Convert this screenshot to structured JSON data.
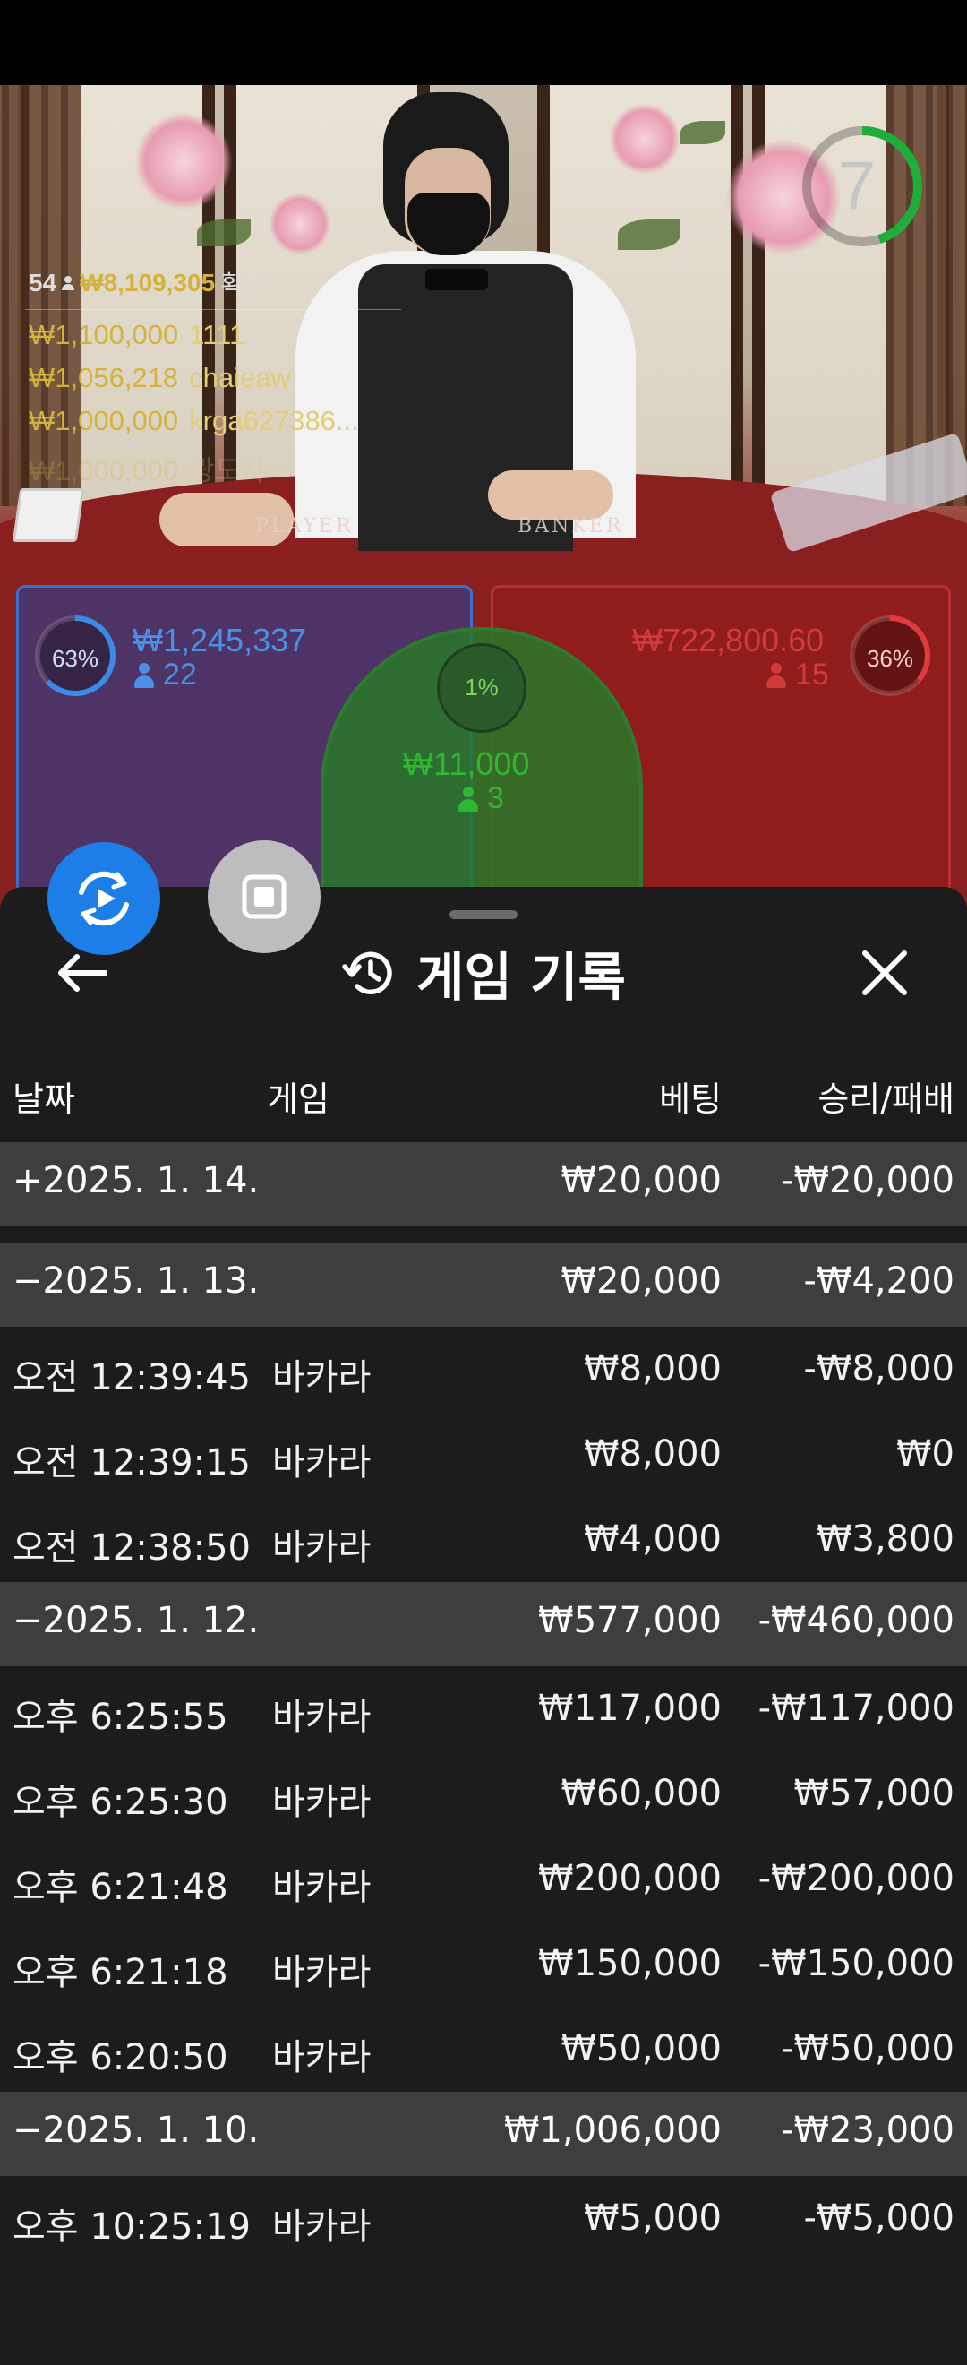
{
  "game_view": {
    "timer_value": "7",
    "timer_progress": 0.45,
    "summary": {
      "player_count": "54",
      "total_amount": "₩8,109,305",
      "total_label": "획득"
    },
    "winners": [
      {
        "amount": "₩1,100,000",
        "name": "1111"
      },
      {
        "amount": "₩1,056,218",
        "name": "chaieaw"
      },
      {
        "amount": "₩1,000,000",
        "name": "krga627386..."
      },
      {
        "amount": "₩1,000,000",
        "name": "광도사"
      }
    ],
    "table_labels": {
      "player": "PLAYER",
      "banker": "BANKER"
    },
    "player_zone": {
      "percent_label": "63%",
      "percent": 63,
      "amount": "₩1,245,337",
      "count": "22",
      "color": "#3a6fd0"
    },
    "banker_zone": {
      "percent_label": "36%",
      "percent": 36,
      "amount": "₩722,800.60",
      "count": "15",
      "color": "#d23a3a"
    },
    "tie_zone": {
      "percent_label": "1%",
      "percent": 1,
      "amount": "₩11,000",
      "count": "3",
      "color": "#2fa52f"
    }
  },
  "sheet": {
    "title": "게임 기록",
    "title_icon": "history-icon",
    "columns": {
      "date": "날짜",
      "game": "게임",
      "bet": "베팅",
      "win_loss": "승리/패배"
    },
    "days": [
      {
        "date": "+2025. 1. 14.",
        "bet": "₩20,000",
        "win_loss": "-₩20,000",
        "rows": []
      },
      {
        "date": "−2025. 1. 13.",
        "bet": "₩20,000",
        "win_loss": "-₩4,200",
        "rows": [
          {
            "time": "오전 12:39:45",
            "game": "바카라",
            "bet": "₩8,000",
            "win_loss": "-₩8,000"
          },
          {
            "time": "오전 12:39:15",
            "game": "바카라",
            "bet": "₩8,000",
            "win_loss": "₩0"
          },
          {
            "time": "오전 12:38:50",
            "game": "바카라",
            "bet": "₩4,000",
            "win_loss": "₩3,800"
          }
        ]
      },
      {
        "date": "−2025. 1. 12.",
        "bet": "₩577,000",
        "win_loss": "-₩460,000",
        "rows": [
          {
            "time": "오후 6:25:55",
            "game": "바카라",
            "bet": "₩117,000",
            "win_loss": "-₩117,000"
          },
          {
            "time": "오후 6:25:30",
            "game": "바카라",
            "bet": "₩60,000",
            "win_loss": "₩57,000"
          },
          {
            "time": "오후 6:21:48",
            "game": "바카라",
            "bet": "₩200,000",
            "win_loss": "-₩200,000"
          },
          {
            "time": "오후 6:21:18",
            "game": "바카라",
            "bet": "₩150,000",
            "win_loss": "-₩150,000"
          },
          {
            "time": "오후 6:20:50",
            "game": "바카라",
            "bet": "₩50,000",
            "win_loss": "-₩50,000"
          }
        ]
      },
      {
        "date": "−2025. 1. 10.",
        "bet": "₩1,006,000",
        "win_loss": "-₩23,000",
        "rows": [
          {
            "time": "오후 10:25:19",
            "game": "바카라",
            "bet": "₩5,000",
            "win_loss": "-₩5,000"
          }
        ]
      }
    ]
  },
  "colors": {
    "sheet_bg": "#1c1c1c",
    "day_row_bg": "#3e3e3e",
    "gold": "#d4b33c",
    "live_button": "#1e7ee8",
    "timer_green": "#1fae3a"
  }
}
